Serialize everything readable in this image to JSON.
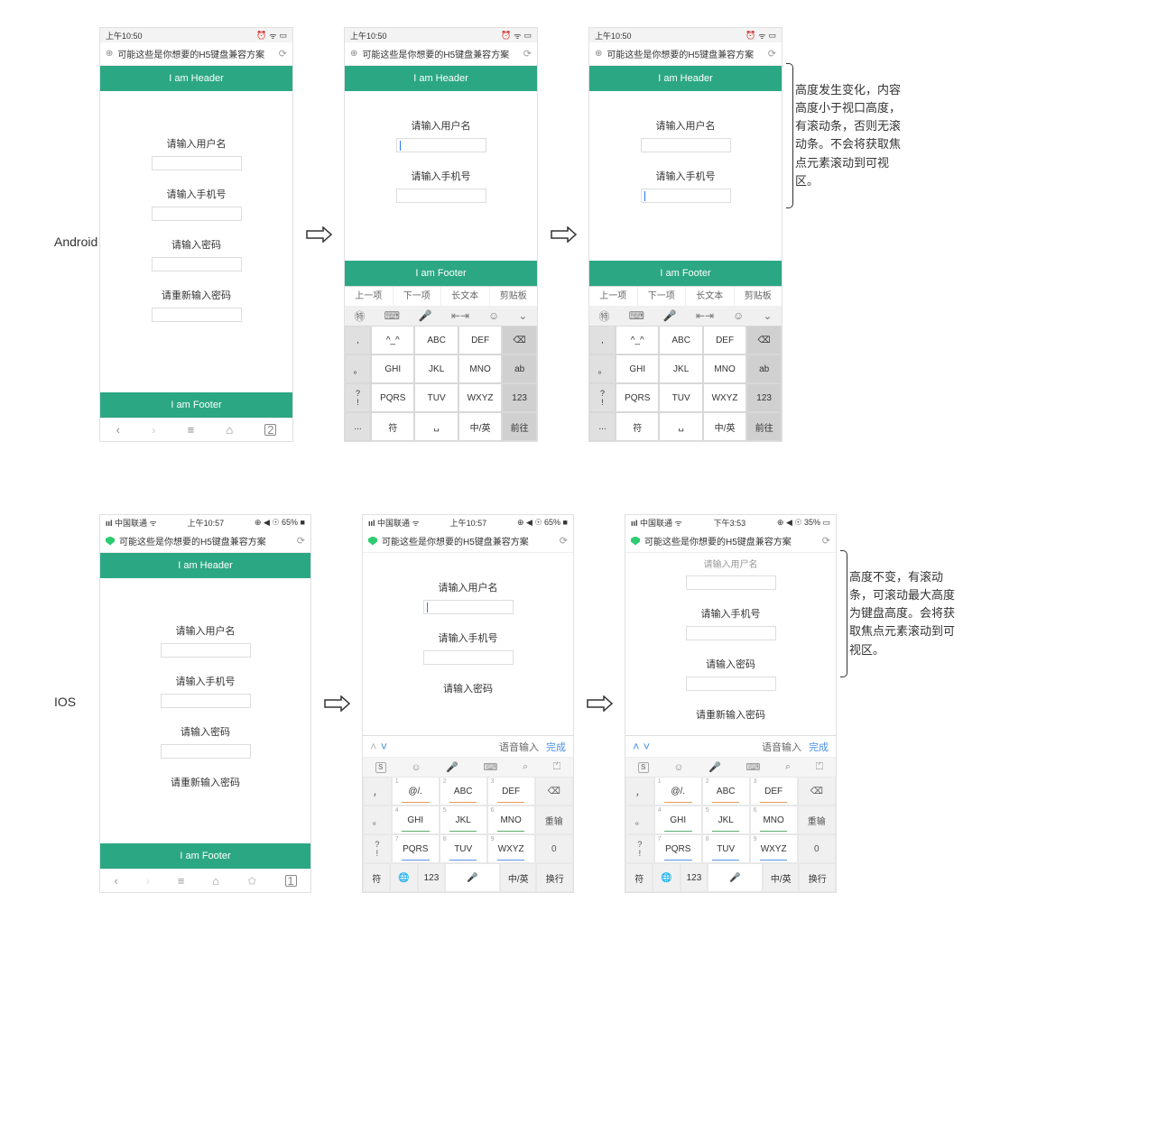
{
  "labels": {
    "android": "Android",
    "ios": "IOS"
  },
  "common": {
    "status_time_android": "上午10:50",
    "status_time_ios": "上午10:57",
    "status_time_ios3": "下午3:53",
    "status_carrier_ios": "中国联通",
    "status_batt_ios": "65%",
    "status_batt_ios3": "35%",
    "page_title": "可能这些是你想要的H5键盘兼容方案",
    "header": "I am Header",
    "footer": "I am Footer",
    "form": {
      "username": "请输入用户名",
      "phone": "请输入手机号",
      "password": "请输入密码",
      "password2": "请重新输入密码",
      "username_partial": "请输入用尸名"
    },
    "nav_tabs_android": "2",
    "nav_tabs_ios": "1"
  },
  "android_ime": {
    "toolbar": [
      "上一项",
      "下一项",
      "长文本",
      "剪贴板"
    ],
    "rows": [
      [
        ",",
        "^_^",
        "ABC",
        "DEF",
        "⌫"
      ],
      [
        "。",
        "GHI",
        "JKL",
        "MNO",
        "ab"
      ],
      [
        "?",
        "PQRS",
        "TUV",
        "WXYZ",
        "123"
      ],
      [
        "!",
        "符",
        "␣",
        "中/英",
        "前往"
      ],
      [
        "...",
        "",
        "",
        "",
        ""
      ]
    ]
  },
  "ios_ime": {
    "voice": "语音输入",
    "done": "完成",
    "rows": [
      [
        "，",
        "@/.",
        "ABC",
        "DEF",
        "⌫"
      ],
      [
        "。",
        "GHI",
        "JKL",
        "MNO",
        "重输"
      ],
      [
        "?",
        "PQRS",
        "TUV",
        "WXYZ",
        "0"
      ],
      [
        "!",
        "",
        "",
        "",
        ""
      ],
      [
        "符",
        "🌐",
        "123",
        "🎤",
        "中/英",
        "换行"
      ]
    ],
    "nums": [
      "1",
      "2",
      "3",
      "4",
      "5",
      "6",
      "7",
      "8",
      "9"
    ]
  },
  "annotations": {
    "android": "高度发生变化，内容高度小于视口高度，有滚动条，否则无滚动条。不会将获取焦点元素滚动到可视区。",
    "ios": "高度不变，有滚动条，可滚动最大高度为键盘高度。会将获取焦点元素滚动到可视区。"
  }
}
